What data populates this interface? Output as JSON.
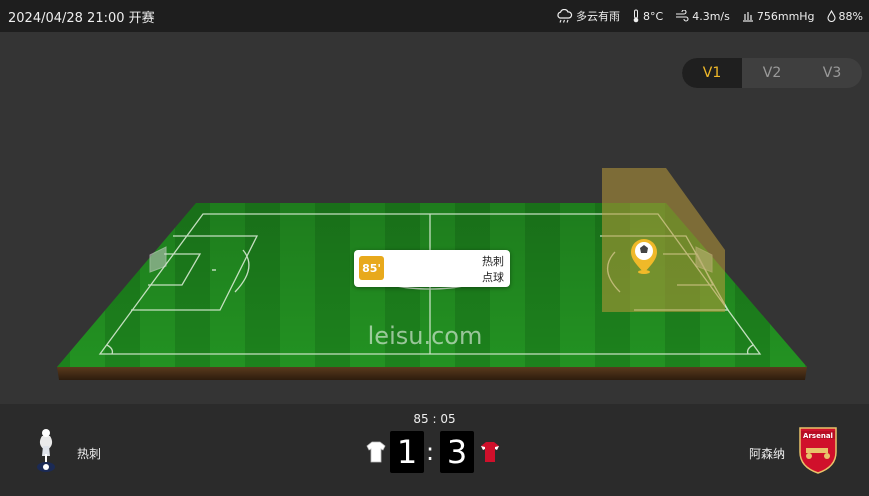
{
  "header": {
    "title": "2024/04/28 21:00 开赛",
    "weather": {
      "condition": "多云有雨",
      "temperature": "8°C",
      "wind": "4.3m/s",
      "pressure": "756mmHg",
      "humidity": "88%"
    }
  },
  "view_tabs": [
    "V1",
    "V2",
    "V3"
  ],
  "active_tab": "V1",
  "pitch": {
    "watermark": "leisu.com",
    "event": {
      "minute": "85'",
      "team": "热刺",
      "type": "点球"
    }
  },
  "match": {
    "time": "85 : 05",
    "home": {
      "name": "热刺",
      "score": "1",
      "shirt_color": "#ffffff",
      "logo_text": ""
    },
    "away": {
      "name": "阿森纳",
      "score": "3",
      "shirt_color": "#d0102b",
      "logo_text": "Arsenal"
    },
    "separator": ":"
  },
  "colors": {
    "accent": "#f0b929",
    "event_badge": "#e8a91c",
    "grass_dark": "#1f8a1f",
    "grass_light": "#2fa12a"
  },
  "icons": {
    "weather": "cloud-rain-icon",
    "temperature": "thermometer-icon",
    "wind": "wind-icon",
    "pressure": "pressure-icon",
    "humidity": "droplet-icon",
    "ball_marker": "ball-pin-icon"
  }
}
